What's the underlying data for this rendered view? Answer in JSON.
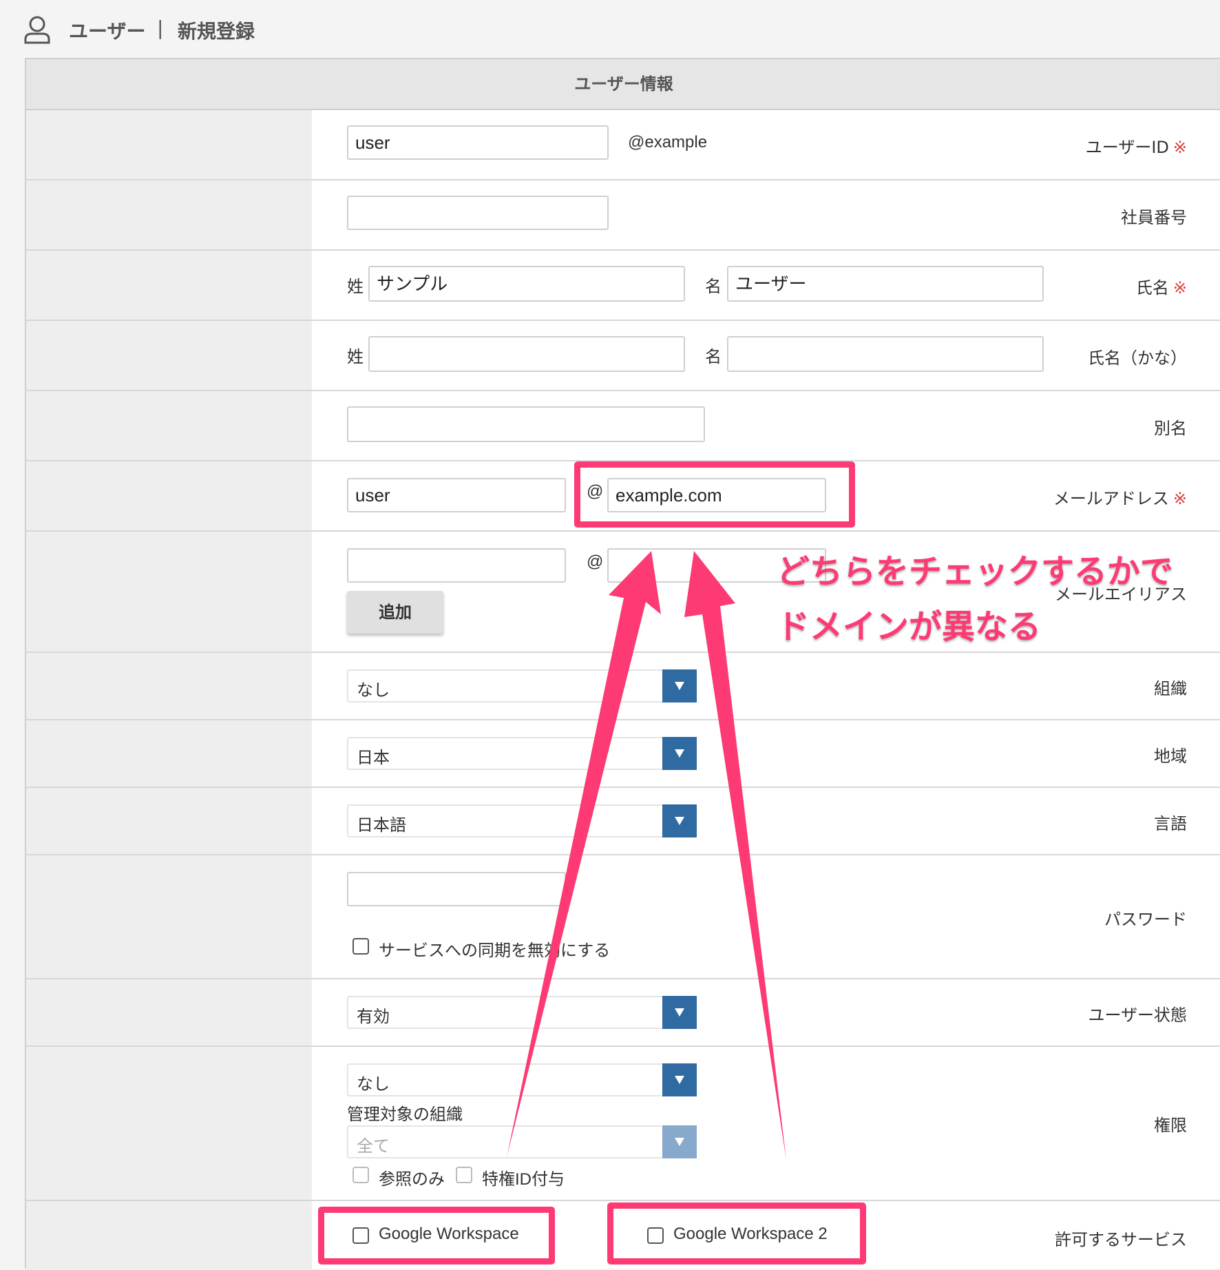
{
  "header": {
    "section": "ユーザー",
    "separator": "|",
    "page": "新規登録"
  },
  "panel": {
    "title": "ユーザー情報"
  },
  "required_mark": "※",
  "form": {
    "user_id": {
      "label": "ユーザーID",
      "value": "user",
      "suffix": "@example"
    },
    "employee_number": {
      "label": "社員番号",
      "value": ""
    },
    "name": {
      "label": "氏名",
      "last_label": "姓",
      "last_value": "サンプル",
      "first_label": "名",
      "first_value": "ユーザー"
    },
    "name_kana": {
      "label": "氏名（かな）",
      "last_label": "姓",
      "last_value": "",
      "first_label": "名",
      "first_value": ""
    },
    "alias": {
      "label": "別名",
      "value": ""
    },
    "email": {
      "label": "メールアドレス",
      "local": "user",
      "at": "@",
      "domain": "example.com"
    },
    "email_alias": {
      "label": "メールエイリアス",
      "local": "",
      "at": "@",
      "domain": "",
      "add_button": "追加"
    },
    "organization": {
      "label": "組織",
      "selected": "なし"
    },
    "region": {
      "label": "地域",
      "selected": "日本"
    },
    "language": {
      "label": "言語",
      "selected": "日本語"
    },
    "password": {
      "label": "パスワード",
      "value": "",
      "disable_sync_label": "サービスへの同期を無効にする"
    },
    "user_status": {
      "label": "ユーザー状態",
      "selected": "有効"
    },
    "permission": {
      "label": "権限",
      "selected": "なし",
      "managed_org_label": "管理対象の組織",
      "managed_org_selected": "全て",
      "read_only_label": "参照のみ",
      "privileged_id_label": "特権ID付与"
    },
    "allowed_services": {
      "label": "許可するサービス",
      "services": [
        "Google Workspace",
        "Google Workspace 2"
      ]
    }
  },
  "annotation": {
    "line1": "どちらをチェックするかで",
    "line2": "ドメインが異なる",
    "color": "#fd3a73"
  },
  "colors": {
    "accent": "#2f6aa3",
    "highlight": "#fd3a73",
    "required": "#d9403a"
  }
}
